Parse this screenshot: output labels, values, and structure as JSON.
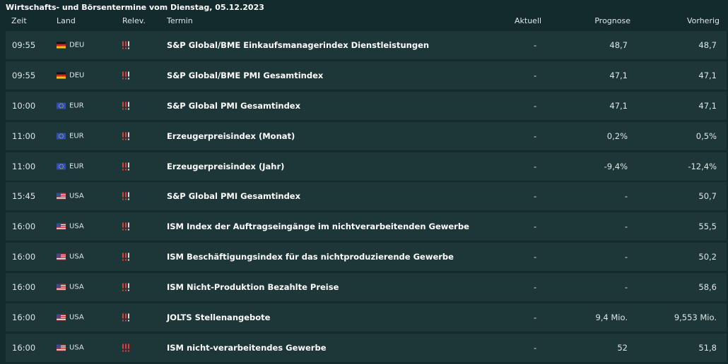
{
  "page_title": "Wirtschafts- und Börsentermine vom Dienstag, 05.12.2023",
  "columns": {
    "zeit": "Zeit",
    "land": "Land",
    "relevanz": "Relev.",
    "termin": "Termin",
    "aktuell": "Aktuell",
    "prognose": "Prognose",
    "vorherig": "Vorherig"
  },
  "colors": {
    "background": "#132b2d",
    "row_background": "#1d3638",
    "relevance_active": "#e23b3b",
    "relevance_inactive": "#d7dede"
  },
  "rows": [
    {
      "time": "09:55",
      "flag": "germany-flag-icon",
      "land": "DEU",
      "relevance": 2,
      "termin": "S&P Global/BME Einkaufsmanagerindex Dienstleistungen",
      "aktuell": "-",
      "prognose": "48,7",
      "vorherig": "48,7"
    },
    {
      "time": "09:55",
      "flag": "germany-flag-icon",
      "land": "DEU",
      "relevance": 2,
      "termin": "S&P Global/BME PMI Gesamtindex",
      "aktuell": "-",
      "prognose": "47,1",
      "vorherig": "47,1"
    },
    {
      "time": "10:00",
      "flag": "eu-flag-icon",
      "land": "EUR",
      "relevance": 2,
      "termin": "S&P Global PMI Gesamtindex",
      "aktuell": "-",
      "prognose": "47,1",
      "vorherig": "47,1"
    },
    {
      "time": "11:00",
      "flag": "eu-flag-icon",
      "land": "EUR",
      "relevance": 2,
      "termin": "Erzeugerpreisindex (Monat)",
      "aktuell": "-",
      "prognose": "0,2%",
      "vorherig": "0,5%"
    },
    {
      "time": "11:00",
      "flag": "eu-flag-icon",
      "land": "EUR",
      "relevance": 2,
      "termin": "Erzeugerpreisindex (Jahr)",
      "aktuell": "-",
      "prognose": "-9,4%",
      "vorherig": "-12,4%"
    },
    {
      "time": "15:45",
      "flag": "usa-flag-icon",
      "land": "USA",
      "relevance": 2,
      "termin": "S&P Global PMI Gesamtindex",
      "aktuell": "-",
      "prognose": "-",
      "vorherig": "50,7"
    },
    {
      "time": "16:00",
      "flag": "usa-flag-icon",
      "land": "USA",
      "relevance": 2,
      "termin": "ISM Index der Auftragseingänge im nichtverarbeitenden Gewerbe",
      "aktuell": "-",
      "prognose": "-",
      "vorherig": "55,5"
    },
    {
      "time": "16:00",
      "flag": "usa-flag-icon",
      "land": "USA",
      "relevance": 2,
      "termin": "ISM Beschäftigungsindex für das nichtproduzierende Gewerbe",
      "aktuell": "-",
      "prognose": "-",
      "vorherig": "50,2"
    },
    {
      "time": "16:00",
      "flag": "usa-flag-icon",
      "land": "USA",
      "relevance": 2,
      "termin": "ISM Nicht-Produktion Bezahlte Preise",
      "aktuell": "-",
      "prognose": "-",
      "vorherig": "58,6"
    },
    {
      "time": "16:00",
      "flag": "usa-flag-icon",
      "land": "USA",
      "relevance": 2,
      "termin": "JOLTS Stellenangebote",
      "aktuell": "-",
      "prognose": "9,4 Mio.",
      "vorherig": "9,553 Mio."
    },
    {
      "time": "16:00",
      "flag": "usa-flag-icon",
      "land": "USA",
      "relevance": 3,
      "termin": "ISM nicht-verarbeitendes Gewerbe",
      "aktuell": "-",
      "prognose": "52",
      "vorherig": "51,8"
    }
  ]
}
